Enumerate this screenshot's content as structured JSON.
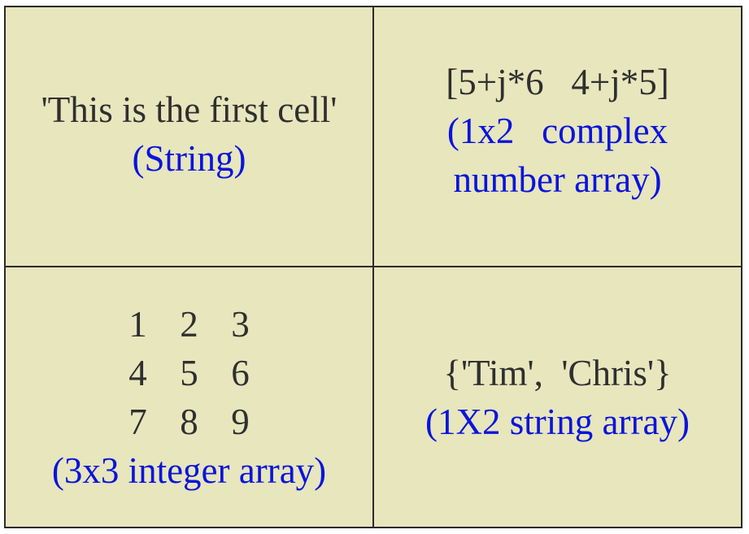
{
  "cells": {
    "top_left": {
      "value": "'This is the first cell'",
      "type_label": "(String)"
    },
    "top_right": {
      "value": "[5+j*6   4+j*5]",
      "type_label_line1": "(1x2   complex",
      "type_label_line2": "number array)"
    },
    "bottom_left": {
      "matrix": [
        [
          "1",
          "2",
          "3"
        ],
        [
          "4",
          "5",
          "6"
        ],
        [
          "7",
          "8",
          "9"
        ]
      ],
      "type_label": "(3x3 integer array)"
    },
    "bottom_right": {
      "value": "{'Tim',  'Chris'}",
      "type_label": "(1X2 string array)"
    }
  },
  "colors": {
    "background": "#e7e6bd",
    "text": "#2f2f2f",
    "label": "#0a14dc",
    "border": "#2b2b2b"
  }
}
